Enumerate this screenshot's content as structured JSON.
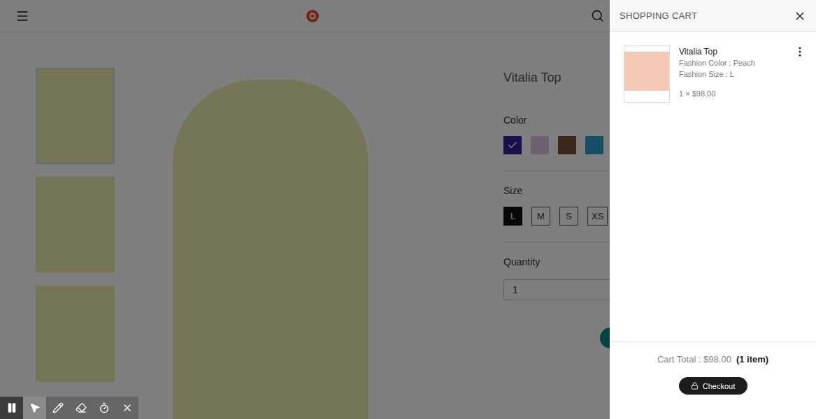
{
  "product": {
    "name": "Vitalia Top",
    "color_label": "Color",
    "colors": [
      {
        "color": "#3a1a9a",
        "selected": true
      },
      {
        "color": "#d9c4dc",
        "selected": false
      },
      {
        "color": "#7a5038",
        "selected": false
      },
      {
        "color": "#2b9fd0",
        "selected": false
      }
    ],
    "size_label": "Size",
    "sizes": [
      {
        "label": "L",
        "selected": true
      },
      {
        "label": "M",
        "selected": false
      },
      {
        "label": "S",
        "selected": false
      },
      {
        "label": "XS",
        "selected": false
      }
    ],
    "quantity_label": "Quantity",
    "quantity": "1"
  },
  "thumbnails": [
    {
      "selected": true
    },
    {
      "selected": false
    },
    {
      "selected": false
    }
  ],
  "cart": {
    "title": "SHOPPING CART",
    "items": [
      {
        "name": "Vitalia Top",
        "color_line": "Fashion Color : Peach",
        "size_line": "Fashion Size : L",
        "qty_price": "1 × $98.00"
      }
    ],
    "total_label": "Cart Total : $98.00",
    "count": "(1 item)",
    "checkout": "Checkout"
  },
  "tools": [
    {
      "selected": false
    },
    {
      "selected": true
    },
    {
      "selected": false
    },
    {
      "selected": false
    },
    {
      "selected": false
    },
    {
      "selected": false
    }
  ]
}
